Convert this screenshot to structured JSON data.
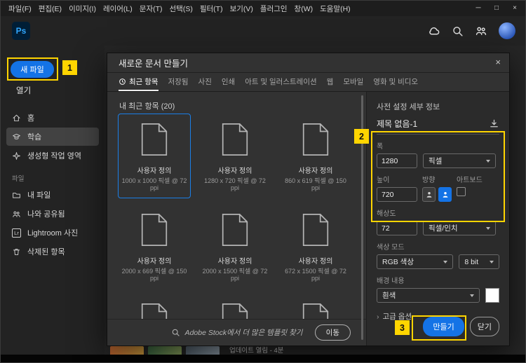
{
  "colors": {
    "accent_blue": "#1473e6",
    "annotation_yellow": "#ffd500",
    "selection_blue": "#1a7fe8"
  },
  "window": {
    "minimize_glyph": "─",
    "maximize_glyph": "□",
    "close_glyph": "×"
  },
  "app": {
    "logo_text": "Ps",
    "menu_items": [
      "파일(F)",
      "편집(E)",
      "이미지(I)",
      "레이어(L)",
      "문자(T)",
      "선택(S)",
      "필터(T)",
      "보기(V)",
      "플러그인",
      "창(W)",
      "도움말(H)"
    ]
  },
  "sidebar": {
    "new_file_label": "새 파일",
    "open_label": "열기",
    "files_section_label": "파일",
    "nav": [
      {
        "id": "home",
        "icon": "home-icon",
        "label": "홈"
      },
      {
        "id": "learn",
        "icon": "learn-icon",
        "label": "학습",
        "active": true
      },
      {
        "id": "generative-workspace",
        "icon": "generative-icon",
        "label": "생성형 작업 영역"
      },
      {
        "id": "files",
        "section": true,
        "label": "파일"
      },
      {
        "id": "my-files",
        "icon": "files-icon",
        "label": "내 파일"
      },
      {
        "id": "shared-with-me",
        "icon": "shared-icon",
        "label": "나와 공유됨"
      },
      {
        "id": "lightroom-photos",
        "icon": "lightroom-icon",
        "icon_text": "Lr",
        "label": "Lightroom 사진"
      },
      {
        "id": "deleted",
        "icon": "trash-icon",
        "label": "삭제된 항목"
      }
    ]
  },
  "dialog": {
    "title": "새로운 문서 만들기",
    "close_glyph": "×",
    "active_tab": "최근 항목",
    "tabs": [
      {
        "label": "최근 항목",
        "icon": "clock-icon"
      },
      {
        "label": "저장됨"
      },
      {
        "label": "사진"
      },
      {
        "label": "인쇄"
      },
      {
        "label": "아트 및 일러스트레이션"
      },
      {
        "label": "웹"
      },
      {
        "label": "모바일"
      },
      {
        "label": "영화 및 비디오"
      }
    ],
    "section_title": "내 최근 항목 (20)",
    "presets": [
      {
        "name": "사용자 정의",
        "detail": "1000 x 1000 픽셀 @ 72 ppi",
        "selected": true
      },
      {
        "name": "사용자 정의",
        "detail": "1280 x 720 픽셀 @ 72 ppi"
      },
      {
        "name": "사용자 정의",
        "detail": "860 x 619 픽셀 @ 150 ppi"
      },
      {
        "name": "사용자 정의",
        "detail": "2000 x 669 픽셀 @ 150 ppi"
      },
      {
        "name": "사용자 정의",
        "detail": "2000 x 1500 픽셀 @ 72 ppi"
      },
      {
        "name": "사용자 정의",
        "detail": "672 x 1500 픽셀 @ 72 ppi"
      },
      {
        "name": "",
        "detail": ""
      },
      {
        "name": "",
        "detail": ""
      },
      {
        "name": "",
        "detail": ""
      }
    ],
    "stock_bar": {
      "text": "Adobe Stock에서 더 많은 템플릿 찾기",
      "go_label": "이동"
    },
    "details": {
      "panel_title": "사전 설정 세부 정보",
      "doc_title": "제목 없음-1",
      "width_label": "폭",
      "width_value": "1280",
      "width_unit": "픽셀",
      "height_label": "높이",
      "height_value": "720",
      "orientation_label": "방향",
      "artboard_label": "아트보드",
      "resolution_label": "해상도",
      "resolution_value": "72",
      "resolution_unit": "픽셀/인치",
      "color_mode_label": "색상 모드",
      "color_mode_value": "RGB 색상",
      "bit_depth_value": "8 bit",
      "background_label": "배경 내용",
      "background_value": "흰색",
      "advanced_label": "고급 옵션",
      "create_label": "만들기",
      "close_label": "닫기"
    }
  },
  "background": {
    "caption": "업데이트 열림 - 4분"
  },
  "annotations": {
    "step1": "1",
    "step2": "2",
    "step3": "3"
  }
}
